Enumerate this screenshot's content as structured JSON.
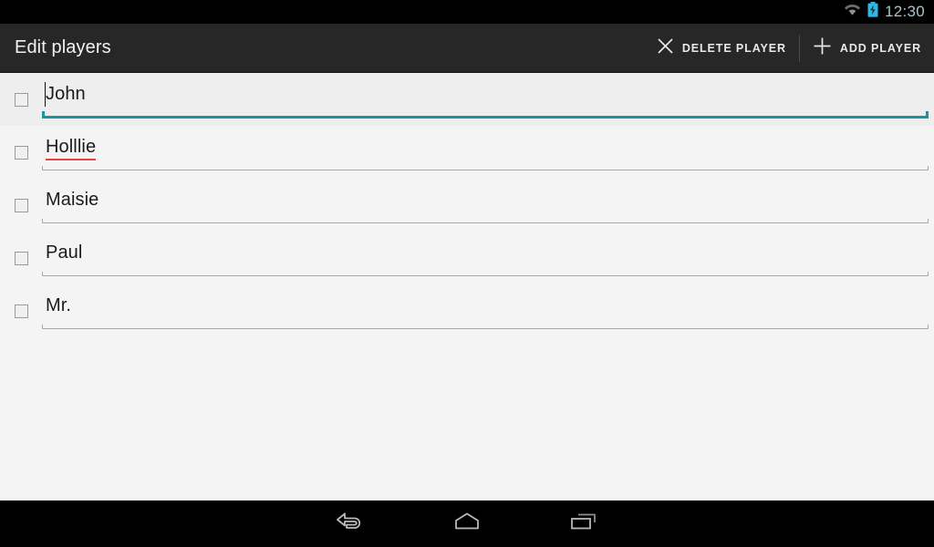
{
  "status_bar": {
    "wifi_icon": "wifi-icon",
    "battery_icon": "battery-charging-icon",
    "time": "12:30",
    "colors": {
      "background": "#000000",
      "time_text": "#a8c4d0",
      "battery": "#33b5e5",
      "wifi": "#8a8a8a"
    }
  },
  "action_bar": {
    "title": "Edit players",
    "background": "#272727",
    "actions": [
      {
        "id": "delete-player",
        "label": "DELETE PLAYER",
        "icon": "close-x-icon"
      },
      {
        "id": "add-player",
        "label": "ADD PLAYER",
        "icon": "plus-icon"
      }
    ]
  },
  "player_list": {
    "focused_index": 0,
    "focus_color": "#1e90a8",
    "spellcheck_color": "#e8443f",
    "rows": [
      {
        "name": "John",
        "checked": false,
        "focused": true,
        "spellcheck_error": false,
        "caret_before_text": true
      },
      {
        "name": "Holllie",
        "checked": false,
        "focused": false,
        "spellcheck_error": true,
        "caret_before_text": false
      },
      {
        "name": "Maisie",
        "checked": false,
        "focused": false,
        "spellcheck_error": false,
        "caret_before_text": false
      },
      {
        "name": "Paul",
        "checked": false,
        "focused": false,
        "spellcheck_error": false,
        "caret_before_text": false
      },
      {
        "name": "Mr.",
        "checked": false,
        "focused": false,
        "spellcheck_error": false,
        "caret_before_text": false
      }
    ]
  },
  "navigation_bar": {
    "background": "#000000",
    "buttons": [
      {
        "id": "back",
        "icon": "back-arrow-icon"
      },
      {
        "id": "home",
        "icon": "home-icon"
      },
      {
        "id": "recents",
        "icon": "recents-icon"
      }
    ]
  }
}
